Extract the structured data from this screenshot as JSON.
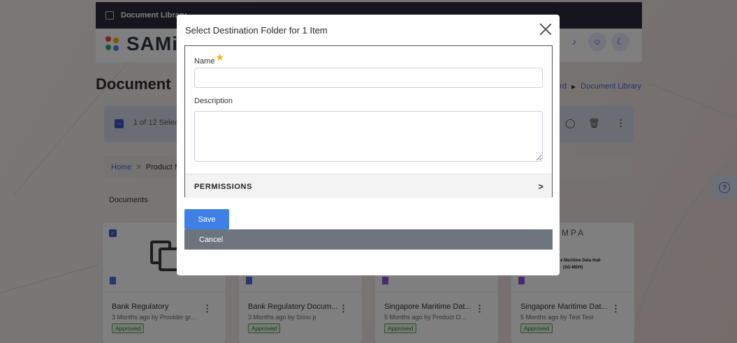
{
  "app": {
    "topbar_title": "Document Library",
    "logo_text": "SAMi",
    "page_title": "Document",
    "breadcrumb": {
      "prev": "rd",
      "current": "Document Library"
    }
  },
  "toolbar": {
    "selection_text": "1 of 12 Select"
  },
  "path": {
    "home": "Home",
    "separator": ">",
    "crumb": "Product M"
  },
  "documents_label": "Documents",
  "cards": [
    {
      "title": "Bank Regulatory",
      "meta": "3 Months ago by Provider gr...",
      "status": "Approved"
    },
    {
      "title": "Bank Regulatory Docum...",
      "meta": "3 Months ago by Srinu p",
      "status": "Approved"
    },
    {
      "title": "Singapore Maritime Dat...",
      "meta": "5 Months ago by Product O...",
      "status": "Approved"
    },
    {
      "title": "Singapore Maritime Dat...",
      "meta": "5 Months ago by Test Test",
      "status": "Approved"
    }
  ],
  "card4_thumb": {
    "logo": "MPA",
    "line1": "e Maritime Data Hub",
    "line2": "(SG-MDH)"
  },
  "modal": {
    "title": "Select Destination Folder for 1 Item",
    "name_label": "Name",
    "name_value": "",
    "description_label": "Description",
    "description_value": "",
    "permissions_label": "PERMISSIONS",
    "save_label": "Save",
    "cancel_label": "Cancel"
  },
  "icons": {
    "close": "close-icon",
    "chevron": "chevron-right-icon",
    "help": "help-icon",
    "bell": "bell-icon",
    "user": "user-icon",
    "theme": "moon-icon"
  },
  "colors": {
    "primary": "#3f80e6",
    "secondary": "#6c757d",
    "required": "#f2b705",
    "header_dark": "#2b2d3a",
    "approved": "#2b7a2b"
  }
}
